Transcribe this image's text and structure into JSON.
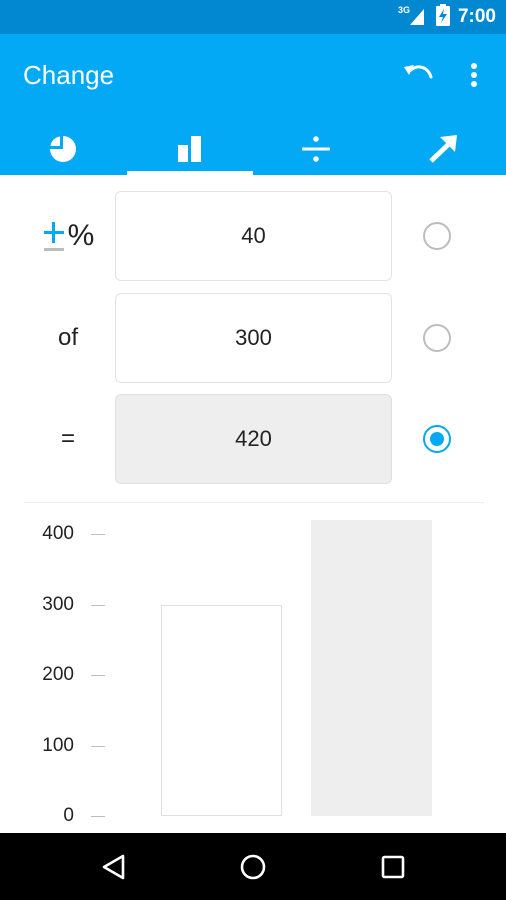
{
  "status_bar": {
    "network": "3G",
    "time": "7:00"
  },
  "app_bar": {
    "title": "Change",
    "actions": [
      "undo-icon",
      "more-vert-icon"
    ]
  },
  "tabs": [
    {
      "icon": "pie-chart-icon",
      "active": false
    },
    {
      "icon": "bar-chart-icon",
      "active": true
    },
    {
      "icon": "divide-icon",
      "active": false
    },
    {
      "icon": "trending-up-arrow-icon",
      "active": false
    }
  ],
  "calculator": {
    "percent_row": {
      "label": "%",
      "icon": "plus-minus-icon",
      "value": "40",
      "selected": false
    },
    "base_row": {
      "label": "of",
      "value": "300",
      "selected": false
    },
    "result_row": {
      "label": "=",
      "value": "420",
      "selected": true
    }
  },
  "chart_data": {
    "type": "bar",
    "categories": [
      "",
      ""
    ],
    "values": [
      300,
      420
    ],
    "yticks": [
      "0",
      "100",
      "200",
      "300",
      "400"
    ],
    "ylim": [
      0,
      420
    ],
    "colors": [
      "#ffffff",
      "#eeeeee"
    ],
    "grid": false
  },
  "nav_bar": {
    "buttons": [
      "back-icon",
      "home-icon",
      "recents-icon"
    ]
  },
  "colors": {
    "primary": "#03a9f4",
    "primary_dark": "#0288d1"
  }
}
